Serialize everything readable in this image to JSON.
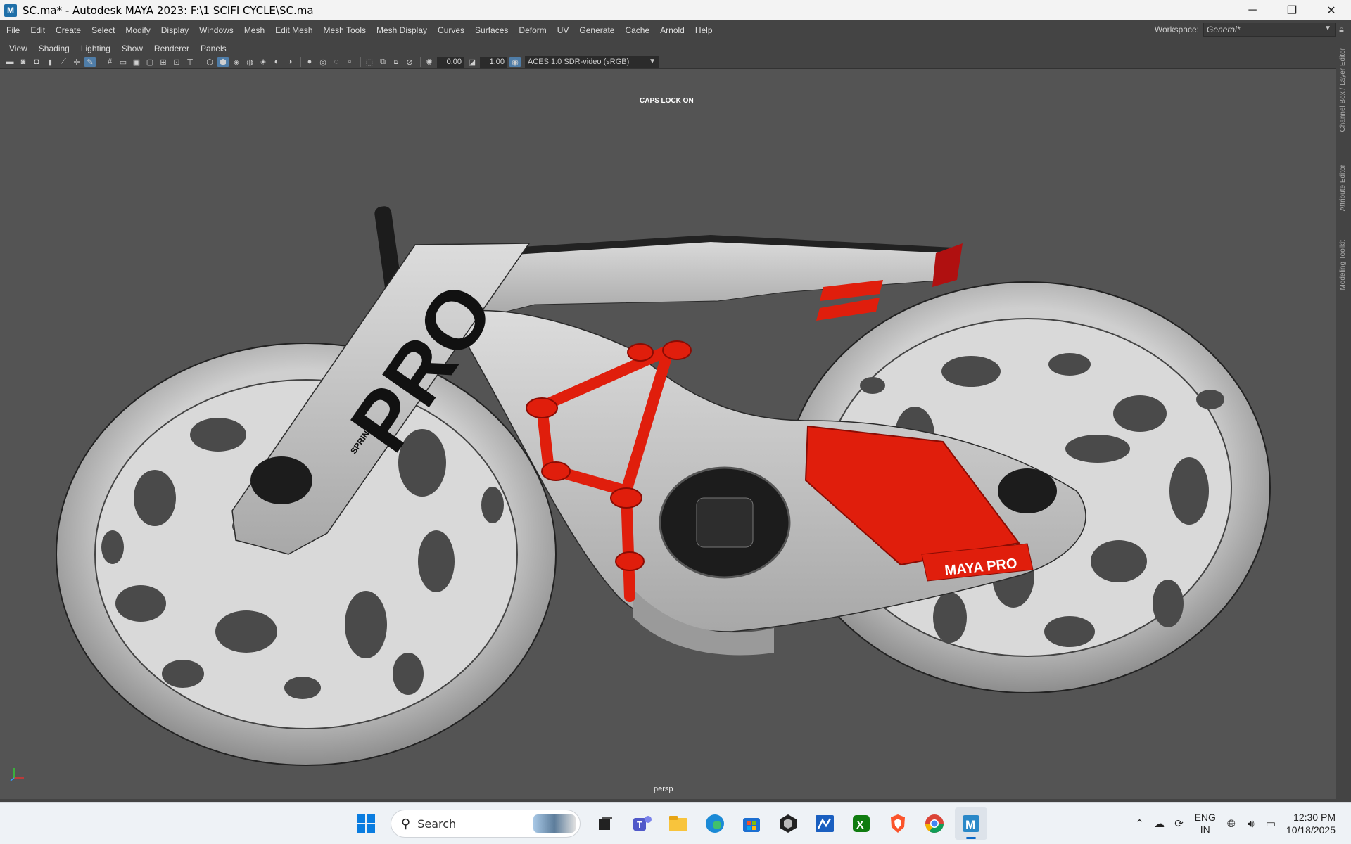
{
  "window": {
    "app_icon_letter": "M",
    "title": "SC.ma* - Autodesk MAYA 2023: F:\\1 SCIFI CYCLE\\SC.ma",
    "minimize": "─",
    "restore": "❐",
    "close": "✕"
  },
  "menubar": {
    "items": [
      "File",
      "Edit",
      "Create",
      "Select",
      "Modify",
      "Display",
      "Windows",
      "Mesh",
      "Edit Mesh",
      "Mesh Tools",
      "Mesh Display",
      "Curves",
      "Surfaces",
      "Deform",
      "UV",
      "Generate",
      "Cache",
      "Arnold",
      "Help"
    ],
    "workspace_label": "Workspace:",
    "workspace_value": "General*"
  },
  "panel_menu": {
    "items": [
      "View",
      "Shading",
      "Lighting",
      "Show",
      "Renderer",
      "Panels"
    ]
  },
  "panel_toolbar": {
    "exposure": "0.00",
    "gamma": "1.00",
    "color_management": "ACES 1.0 SDR-video (sRGB)"
  },
  "viewport": {
    "hud_message": "CAPS LOCK ON",
    "camera": "persp",
    "fork_decal": "PRO",
    "fork_decal_small": "SPRINT",
    "plate_decal": "MAYA PRO",
    "colors": {
      "background": "#545454",
      "frame": "#c9c9c9",
      "accent_red": "#e01e0c",
      "dark": "#1c1c1c"
    }
  },
  "right_dock": {
    "tabs": [
      "Channel Box / Layer Editor",
      "Attribute Editor",
      "Modeling Toolkit"
    ]
  },
  "taskbar": {
    "search_placeholder": "Search",
    "apps": [
      "start-icon",
      "task-view-icon",
      "teams-icon",
      "file-explorer-icon",
      "edge-icon",
      "store-icon",
      "unity-icon",
      "maya-lt-icon",
      "xbox-icon",
      "brave-icon",
      "chrome-icon",
      "maya-icon"
    ],
    "language_line1": "ENG",
    "language_line2": "IN",
    "time": "12:30 PM",
    "date": "10/18/2025"
  }
}
